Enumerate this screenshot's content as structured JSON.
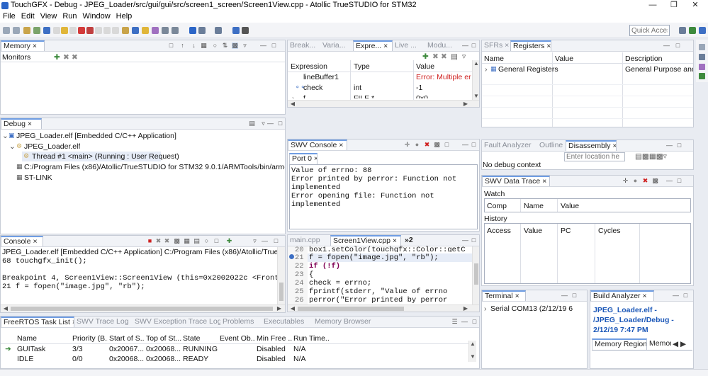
{
  "window": {
    "title": "TouchGFX - Debug - JPEG_Loader/src/gui/gui/src/screen1_screen/Screen1View.cpp - Atollic TrueSTUDIO for STM32"
  },
  "menu": [
    "File",
    "Edit",
    "View",
    "Run",
    "Window",
    "Help"
  ],
  "quick_access": {
    "placeholder": "Quick Access"
  },
  "memory_panel": {
    "tab": "Memory",
    "monitors_label": "Monitors"
  },
  "expressions_panel": {
    "tabs": [
      "Break...",
      "Varia...",
      "Expre...",
      "Live ...",
      "Modu..."
    ],
    "columns": [
      "Expression",
      "Type",
      "Value"
    ],
    "rows": [
      {
        "expression": "lineBuffer1",
        "type": "",
        "value": "Error: Multiple erro"
      },
      {
        "expression": "check",
        "type": "int",
        "value": "-1"
      },
      {
        "expression": "f",
        "type": "FILE *",
        "value": "0x0"
      }
    ]
  },
  "registers_panel": {
    "tabs": [
      "SFRs",
      "Registers"
    ],
    "columns": [
      "Name",
      "Value",
      "Description"
    ],
    "rows": [
      {
        "name": "General Registers",
        "value": "",
        "description": "General Purpose and ..."
      }
    ]
  },
  "debug_panel": {
    "tab": "Debug",
    "tree": [
      "JPEG_Loader.elf [Embedded C/C++ Application]",
      "JPEG_Loader.elf",
      "Thread #1 <main> (Running : User Request)",
      "C:/Program Files (x86)/Atollic/TrueSTUDIO for STM32 9.0.1/ARMTools/bin/arm-atollic-eab",
      "ST-LINK"
    ]
  },
  "swv_console": {
    "tab": "SWV Console",
    "port_tab": "Port 0",
    "lines": [
      "Value of errno: 88",
      "Error printed by perror: Function not",
      "implemented",
      "Error opening file: Function not",
      "implemented"
    ]
  },
  "disassembly_panel": {
    "tabs": [
      "Fault Analyzer",
      "Outline",
      "Disassembly"
    ],
    "location_placeholder": "Enter location he",
    "no_context": "No debug context"
  },
  "swv_data_trace": {
    "tab": "SWV Data Trace",
    "watch_label": "Watch",
    "watch_columns": [
      "Comp",
      "Name",
      "Value"
    ],
    "history_label": "History",
    "history_columns": [
      "Access",
      "Value",
      "PC",
      "Cycles"
    ]
  },
  "console_panel": {
    "tab": "Console",
    "header": "JPEG_Loader.elf [Embedded C/C++ Application] C:/Program Files (x86)/Atollic/TrueSTUDIO for STM",
    "lines": [
      "68            touchgfx_init();",
      "",
      "Breakpoint 4, Screen1View::Screen1View (this=0x2002022c <FrontendHea",
      "21            f = fopen(\"image.jpg\", \"rb\");"
    ]
  },
  "editor": {
    "tabs": [
      "main.cpp",
      "Screen1View.cpp",
      "»2"
    ],
    "lines": [
      {
        "num": "20",
        "code": "    box1.setColor(touchgfx::Color::getC"
      },
      {
        "num": "21",
        "code": "    f = fopen(\"image.jpg\", \"rb\");"
      },
      {
        "num": "22",
        "code": "    if (!f)"
      },
      {
        "num": "23",
        "code": "    {"
      },
      {
        "num": "24",
        "code": "        check = errno;"
      },
      {
        "num": "25",
        "code": "        fprintf(stderr, \"Value of errno"
      },
      {
        "num": "26",
        "code": "        perror(\"Error printed by perror"
      }
    ]
  },
  "terminal_panel": {
    "tab": "Terminal",
    "item": "Serial COM13 (2/12/19 6"
  },
  "build_analyzer": {
    "tab": "Build Analyzer",
    "title_lines": [
      "JPEG_Loader.elf -",
      "/JPEG_Loader/Debug -",
      "2/12/19 7:47 PM"
    ],
    "subtabs": [
      "Memory Regions",
      "Memor"
    ]
  },
  "freertos_panel": {
    "tabs": [
      "FreeRTOS Task List",
      "SWV Trace Log",
      "SWV Exception Trace Log",
      "Problems",
      "Executables",
      "Memory Browser"
    ],
    "columns": [
      "Name",
      "Priority (B...",
      "Start of S...",
      "Top of St...",
      "State",
      "Event Ob...",
      "Min Free ...",
      "Run Time..."
    ],
    "rows": [
      [
        "GUITask",
        "3/3",
        "0x20067...",
        "0x20068...",
        "RUNNING",
        "",
        "Disabled",
        "N/A"
      ],
      [
        "IDLE",
        "0/0",
        "0x20068...",
        "0x20068...",
        "READY",
        "",
        "Disabled",
        "N/A"
      ]
    ]
  }
}
